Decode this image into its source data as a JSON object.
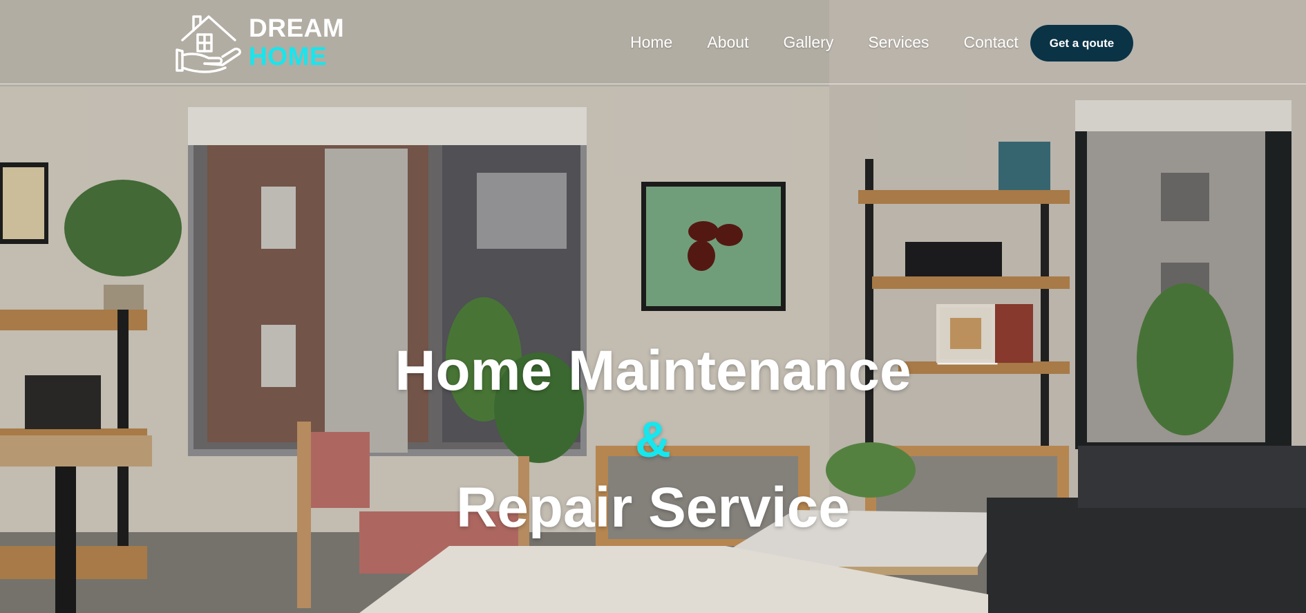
{
  "logo": {
    "line1": "DREAM",
    "line2": "HOME",
    "icon": "house-in-hand-icon"
  },
  "nav": {
    "items": [
      "Home",
      "About",
      "Gallery",
      "Services",
      "Contact"
    ]
  },
  "cta": {
    "label": "Get a qoute"
  },
  "hero": {
    "title_line1": "Home Maintenance",
    "ampersand": "&",
    "title_line2": "Repair Service",
    "background": "living-room-photo"
  },
  "colors": {
    "accent": "#16e6ee",
    "cta_bg": "#0b3346",
    "text": "#ffffff"
  }
}
